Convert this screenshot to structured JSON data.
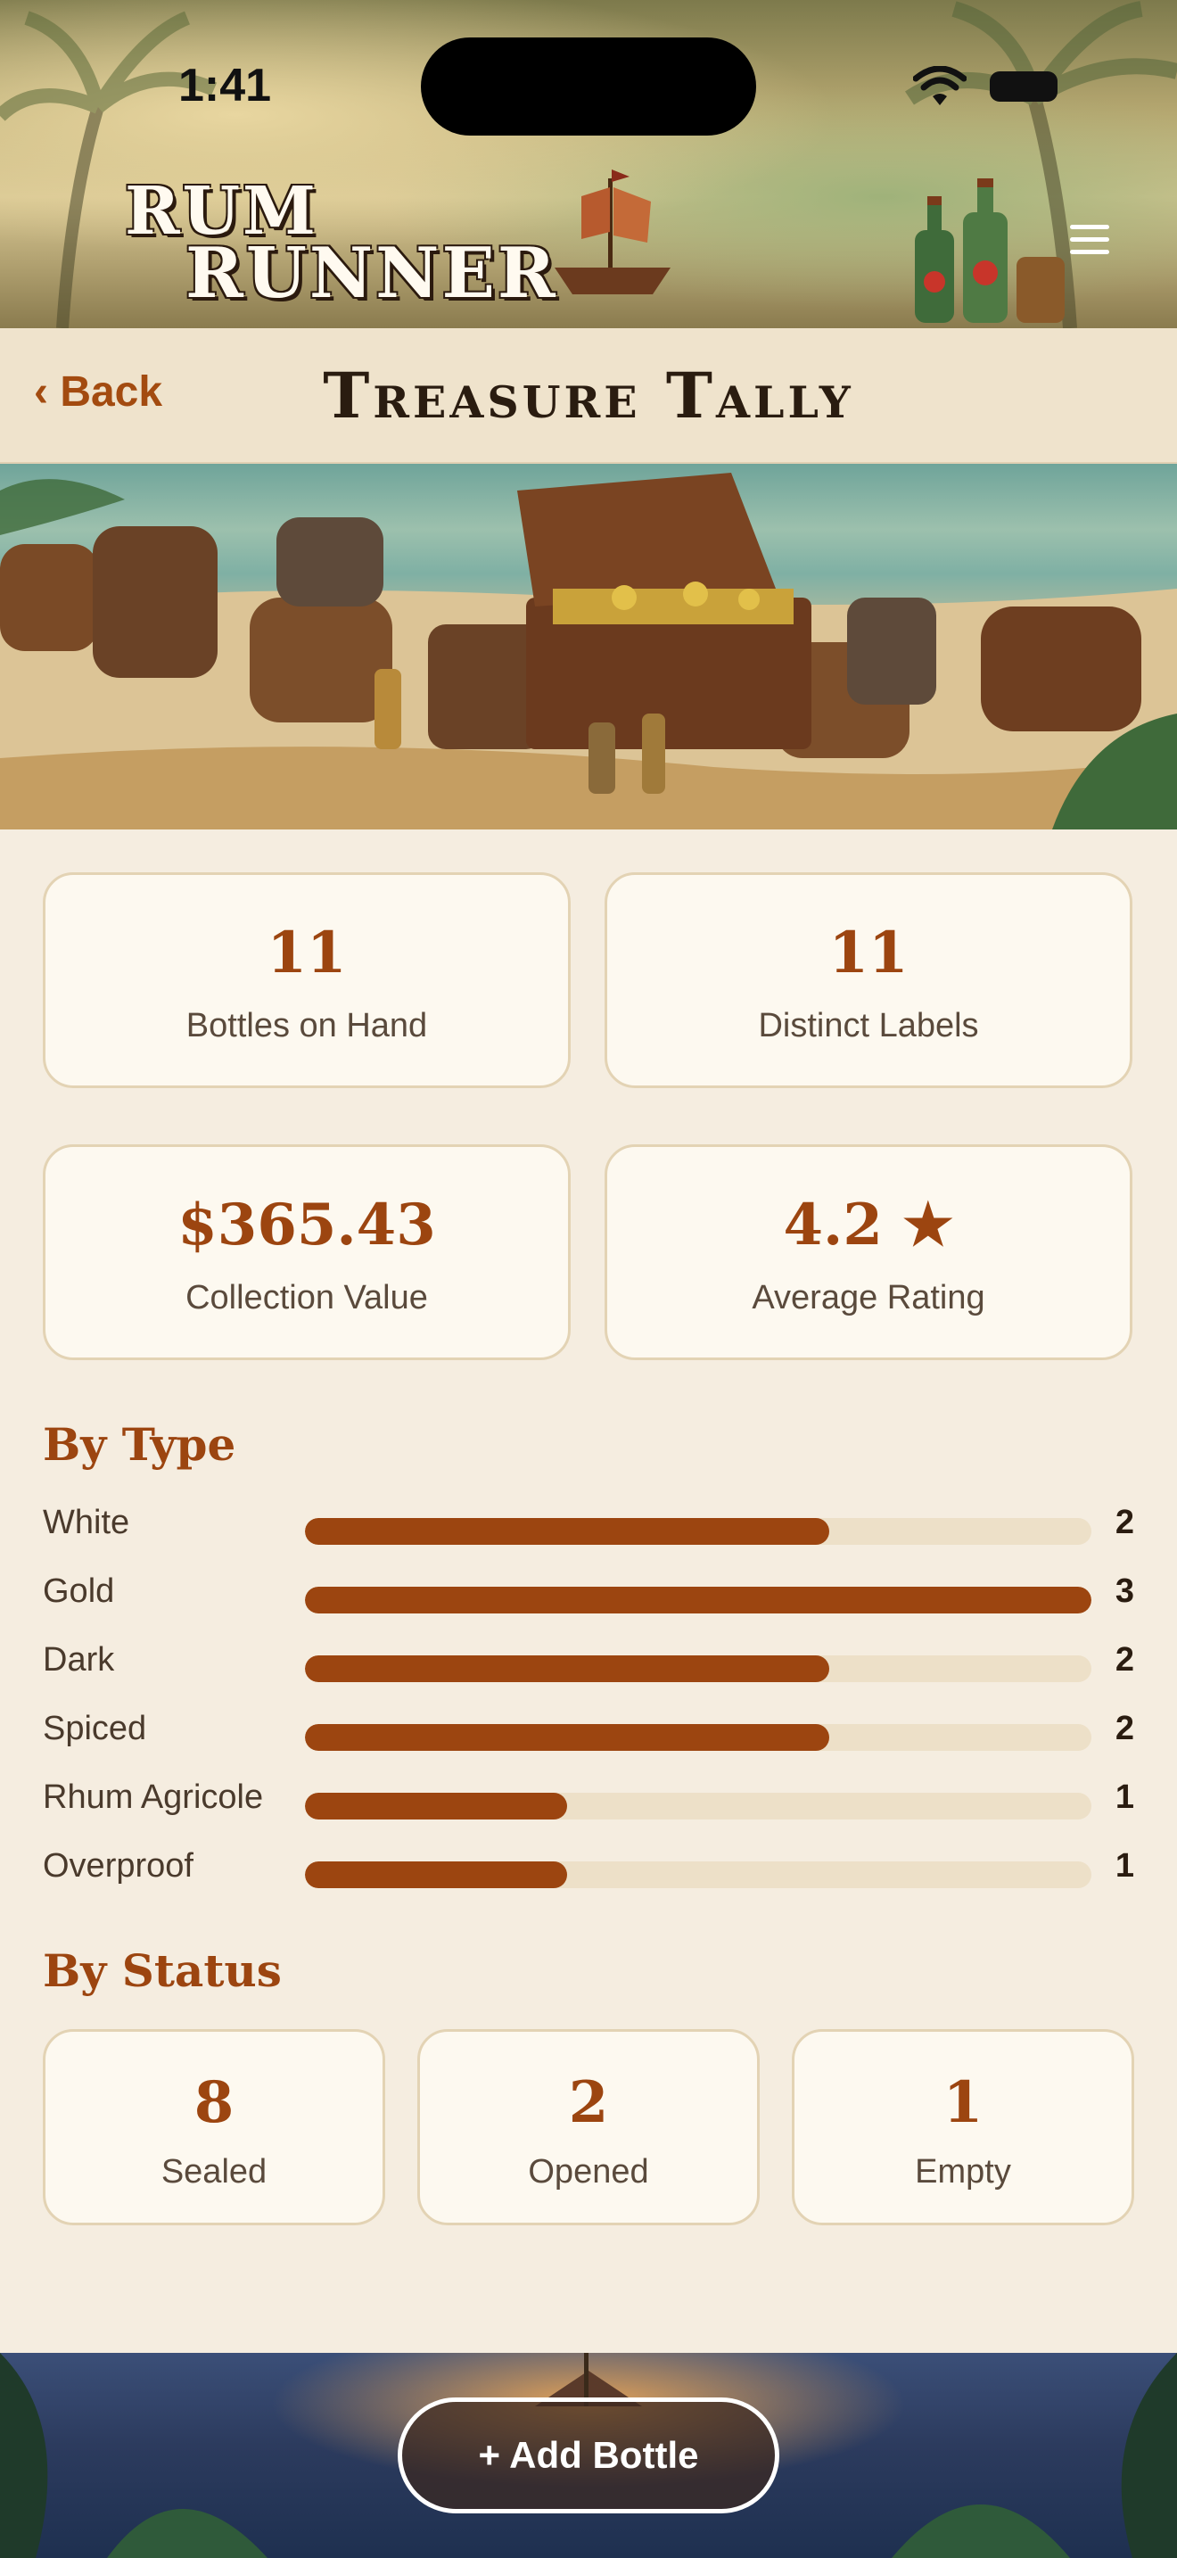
{
  "status_bar": {
    "time": "1:41"
  },
  "header": {
    "logo_line1": "RUM",
    "logo_line2": "RUNNER"
  },
  "nav": {
    "back_label": "‹ Back",
    "title": "Treasure Tally"
  },
  "stats": [
    {
      "value": "11",
      "label": "Bottles on Hand"
    },
    {
      "value": "11",
      "label": "Distinct Labels"
    },
    {
      "value": "$365.43",
      "label": "Collection Value"
    },
    {
      "value": "4.2 ★",
      "label": "Average Rating"
    }
  ],
  "by_type": {
    "title": "By Type",
    "max": 3,
    "rows": [
      {
        "name": "White",
        "count": 2
      },
      {
        "name": "Gold",
        "count": 3
      },
      {
        "name": "Dark",
        "count": 2
      },
      {
        "name": "Spiced",
        "count": 2
      },
      {
        "name": "Rhum Agricole",
        "count": 1
      },
      {
        "name": "Overproof",
        "count": 1
      }
    ]
  },
  "by_status": {
    "title": "By Status",
    "items": [
      {
        "value": "8",
        "label": "Sealed"
      },
      {
        "value": "2",
        "label": "Opened"
      },
      {
        "value": "1",
        "label": "Empty"
      }
    ]
  },
  "footer": {
    "add_label": "+ Add Bottle"
  },
  "colors": {
    "accent": "#9c4510",
    "background": "#f5ede0",
    "card": "#fdf9f0"
  }
}
